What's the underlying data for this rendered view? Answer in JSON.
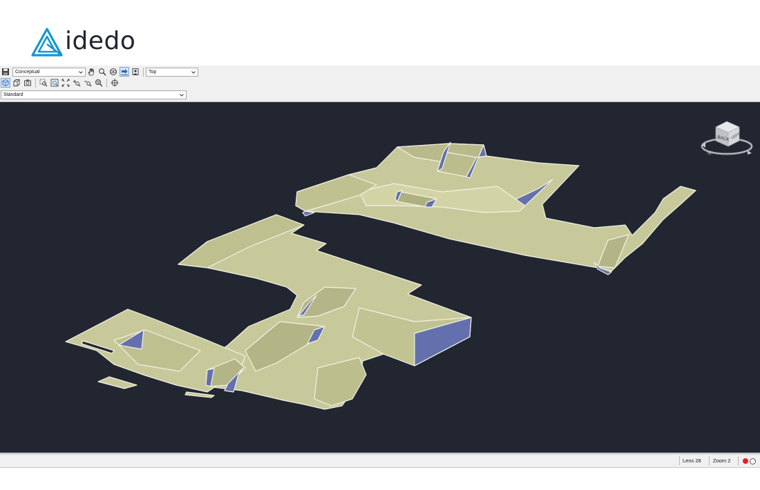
{
  "brand": {
    "name": "idedo",
    "accent": "#1296d4"
  },
  "toolbar": {
    "visual_style": "Conceptual",
    "view": "Top",
    "display_style": "Standard",
    "row1_icons": [
      "save-icon",
      "pan-hand-icon",
      "zoom-icon",
      "orbit-icon",
      "walk-icon",
      "fly-icon"
    ],
    "row2_icons": [
      "view-cube-icon",
      "box-face-icon",
      "camera-icon",
      "zoom-window-icon",
      "zoom-extents-icon",
      "fit-all-icon",
      "zoom-in-icon",
      "zoom-out-icon",
      "zoom-search-icon",
      "target-icon"
    ]
  },
  "viewcube": {
    "face_back": "BACK",
    "face_left": "LEFT",
    "compass_n": "N"
  },
  "status": {
    "lens": "Lens 28",
    "zoom": "Zoom 2"
  },
  "colors": {
    "viewport": "#212630",
    "model_fill": "#c8c99a",
    "model_shadow": "#6470ad",
    "edge": "#f2f2e6"
  }
}
